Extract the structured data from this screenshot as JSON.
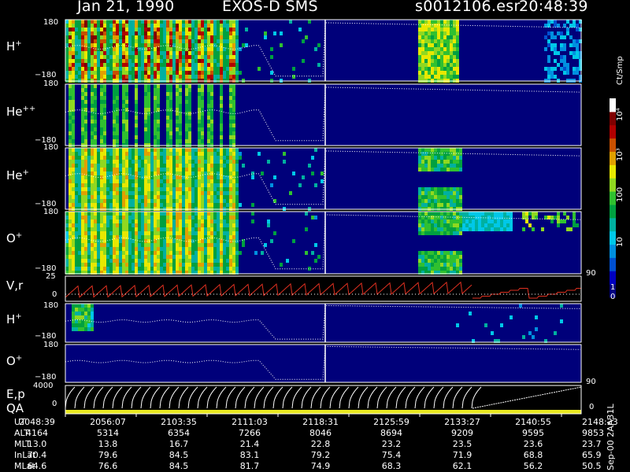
{
  "header": {
    "date": "Jan 21, 1990",
    "instrument": "EXOS-D SMS",
    "file": "s0012106.esr",
    "time": "20:48:39"
  },
  "panels": {
    "hplus": {
      "label": "H",
      "sup": "+",
      "top": "180",
      "bottom": "−180"
    },
    "hepp": {
      "label": "He",
      "sup": "++",
      "top": "180",
      "bottom": "−180"
    },
    "heplus": {
      "label": "He",
      "sup": "+",
      "top": "180",
      "bottom": "−180"
    },
    "oplus": {
      "label": "O",
      "sup": "+",
      "top": "180",
      "bottom": "−180",
      "right": "90"
    },
    "vr": {
      "label": "V,r",
      "top": "25",
      "bottom": "0"
    },
    "hplus2": {
      "label": "H",
      "sup": "+",
      "top": "180",
      "bottom": "−180"
    },
    "oplus2": {
      "label": "O",
      "sup": "+",
      "top": "180",
      "bottom": "−180",
      "right": "90"
    },
    "ep": {
      "label1": "E,p",
      "label2": "QA",
      "top": "4000",
      "bottom": "0",
      "right": "0"
    }
  },
  "colorbar": {
    "unit": "Ct/Smp",
    "ticks": [
      "10⁴",
      "10³",
      "100",
      "10",
      "1",
      "0"
    ],
    "colors": [
      "#000080",
      "#0000c0",
      "#0050d0",
      "#0090e0",
      "#00c8e8",
      "#00b0a0",
      "#00a040",
      "#30c030",
      "#90d820",
      "#e8e800",
      "#e0a000",
      "#c85000",
      "#b00000",
      "#800000",
      "#ffffff"
    ]
  },
  "footer": {
    "rows": [
      {
        "name": "UT",
        "values": [
          "2048:39",
          "2056:07",
          "2103:35",
          "2111:03",
          "2118:31",
          "2125:59",
          "2133:27",
          "2140:55",
          "2148:23"
        ]
      },
      {
        "name": "ALT",
        "values": [
          "4164",
          "5314",
          "6354",
          "7266",
          "8046",
          "8694",
          "9209",
          "9595",
          "9853"
        ]
      },
      {
        "name": "MLT",
        "values": [
          "13.0",
          "13.8",
          "16.7",
          "21.4",
          "22.8",
          "23.2",
          "23.5",
          "23.6",
          "23.7"
        ]
      },
      {
        "name": "InLat",
        "values": [
          "70.4",
          "79.6",
          "84.5",
          "83.1",
          "79.2",
          "75.4",
          "71.9",
          "68.8",
          "65.9"
        ]
      },
      {
        "name": "MLat",
        "values": [
          "64.6",
          "76.6",
          "84.5",
          "81.7",
          "74.9",
          "68.3",
          "62.1",
          "56.2",
          "50.5"
        ]
      }
    ],
    "stamp": "Sep-00 2AA31L"
  },
  "chart_data": {
    "type": "heatmap",
    "title": "Jan 21, 1990   EXOS-D SMS",
    "xlabel": "UT",
    "x_ticks": [
      "2048:39",
      "2056:07",
      "2103:35",
      "2111:03",
      "2118:31",
      "2125:59",
      "2133:27",
      "2140:55",
      "2148:23"
    ],
    "series": [
      {
        "name": "H+",
        "yrange": [
          -180,
          180
        ]
      },
      {
        "name": "He++",
        "yrange": [
          -180,
          180
        ]
      },
      {
        "name": "He+",
        "yrange": [
          -180,
          180
        ]
      },
      {
        "name": "O+",
        "yrange": [
          -180,
          180
        ]
      },
      {
        "name": "V,r",
        "yrange": [
          0,
          25
        ]
      },
      {
        "name": "H+",
        "yrange": [
          -180,
          180
        ]
      },
      {
        "name": "O+",
        "yrange": [
          -180,
          180
        ]
      },
      {
        "name": "E,p",
        "yrange": [
          0,
          4000
        ]
      }
    ],
    "colorbar": {
      "label": "Ct/Smp",
      "scale": "log",
      "range": [
        1,
        10000
      ]
    }
  }
}
